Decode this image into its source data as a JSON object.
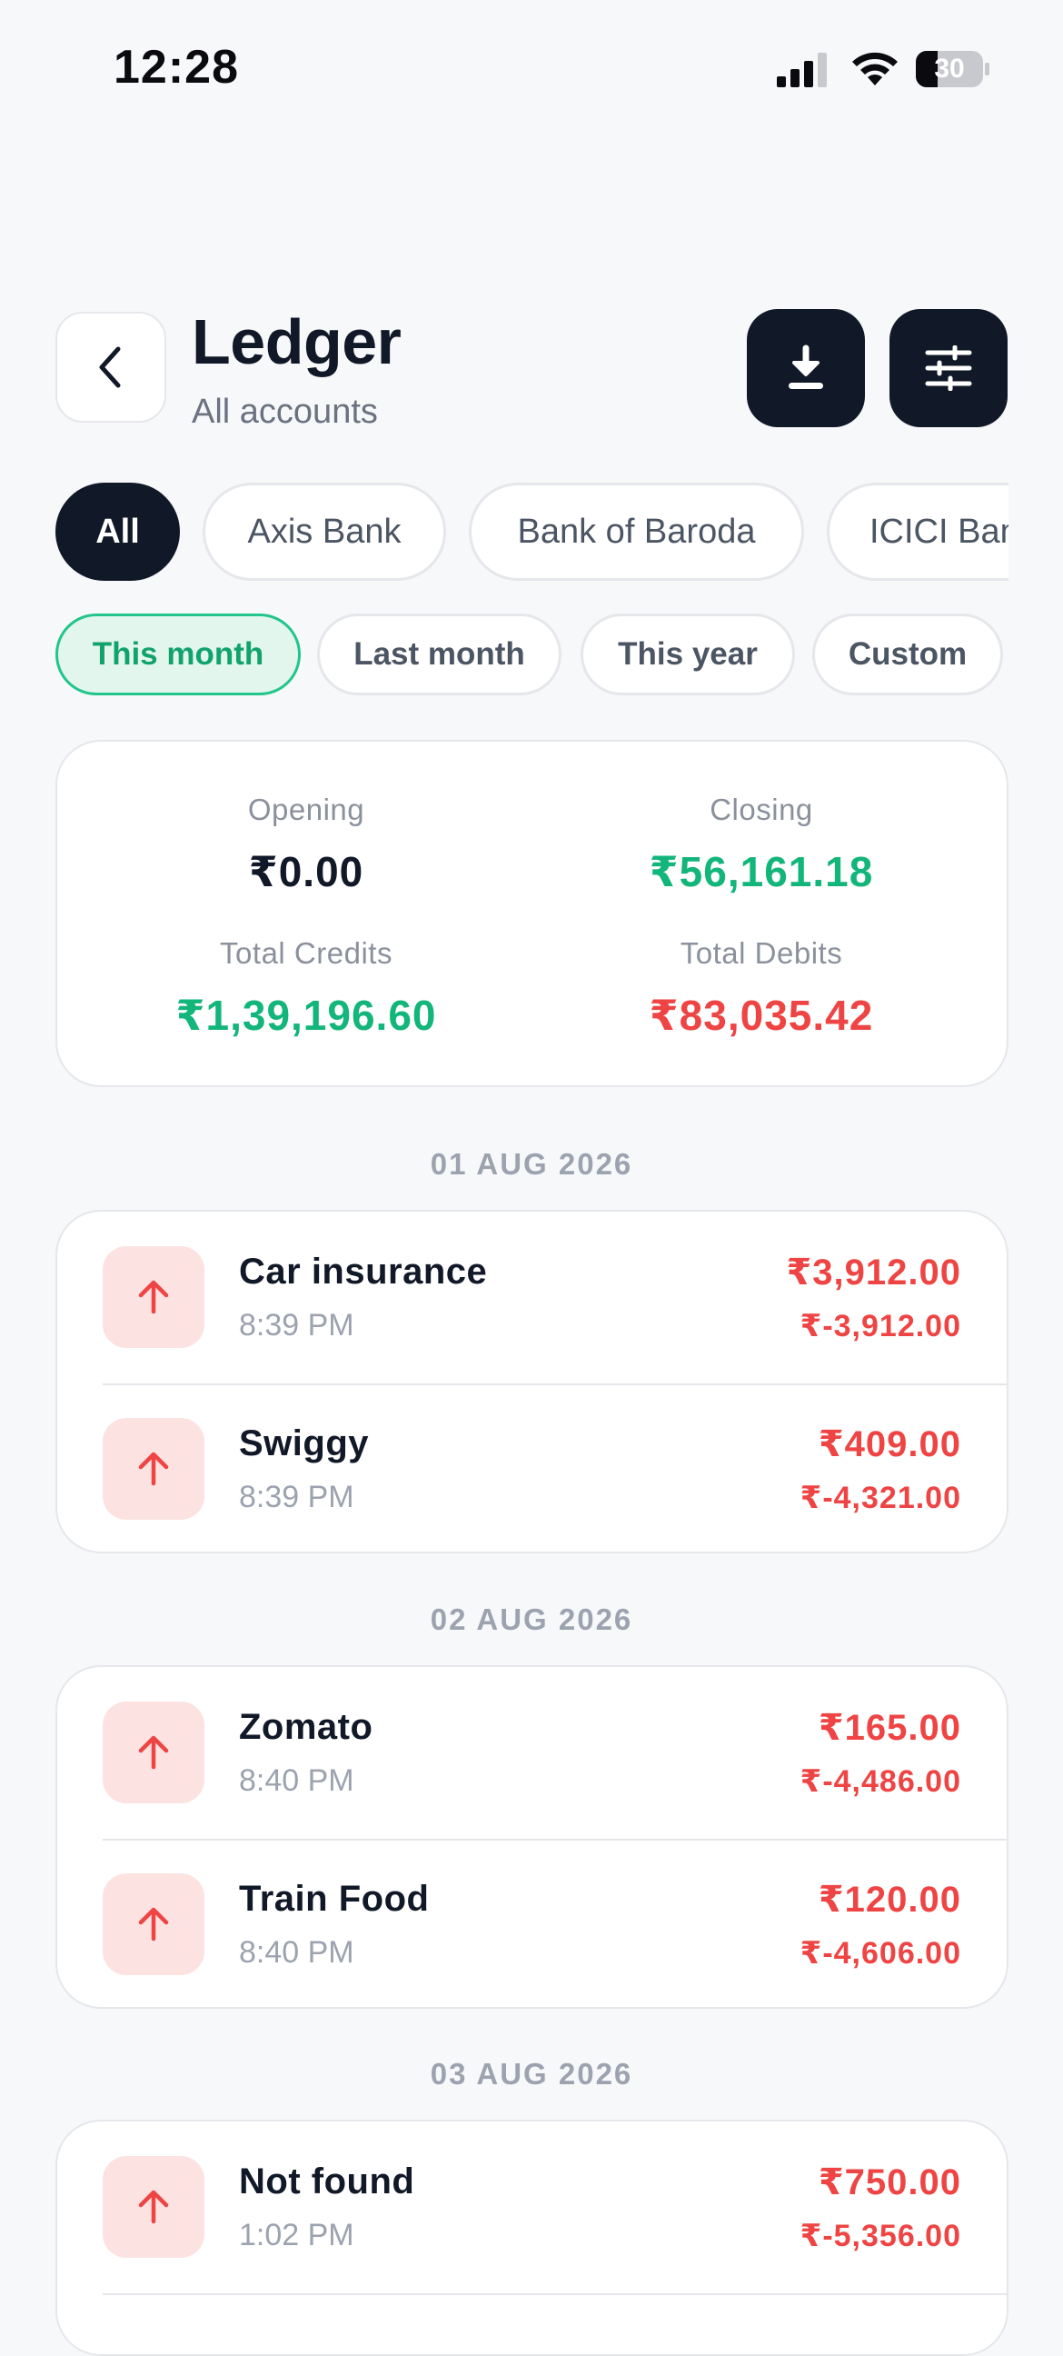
{
  "status_bar": {
    "time": "12:28",
    "battery": "30"
  },
  "header": {
    "title": "Ledger",
    "subtitle": "All accounts"
  },
  "accounts": [
    "All",
    "Axis Bank",
    "Bank of Baroda",
    "ICICI Bank"
  ],
  "periods": [
    "This month",
    "Last month",
    "This year",
    "Custom"
  ],
  "summary": {
    "opening_label": "Opening",
    "opening_value": "₹0.00",
    "closing_label": "Closing",
    "closing_value": "₹56,161.18",
    "credits_label": "Total Credits",
    "credits_value": "₹1,39,196.60",
    "debits_label": "Total Debits",
    "debits_value": "₹83,035.42"
  },
  "colors": {
    "credit": "#12b57a",
    "debit": "#ef4444",
    "dark": "#111827",
    "accent_bg": "#e3f6ee"
  },
  "groups": [
    {
      "date": "01 AUG 2026",
      "items": [
        {
          "name": "Car insurance",
          "time": "8:39 PM",
          "amount": "₹3,912.00",
          "balance": "₹-3,912.00"
        },
        {
          "name": "Swiggy",
          "time": "8:39 PM",
          "amount": "₹409.00",
          "balance": "₹-4,321.00"
        }
      ]
    },
    {
      "date": "02 AUG 2026",
      "items": [
        {
          "name": "Zomato",
          "time": "8:40 PM",
          "amount": "₹165.00",
          "balance": "₹-4,486.00"
        },
        {
          "name": "Train Food",
          "time": "8:40 PM",
          "amount": "₹120.00",
          "balance": "₹-4,606.00"
        }
      ]
    },
    {
      "date": "03 AUG 2026",
      "items": [
        {
          "name": "Not found",
          "time": "1:02 PM",
          "amount": "₹750.00",
          "balance": "₹-5,356.00"
        }
      ]
    }
  ]
}
